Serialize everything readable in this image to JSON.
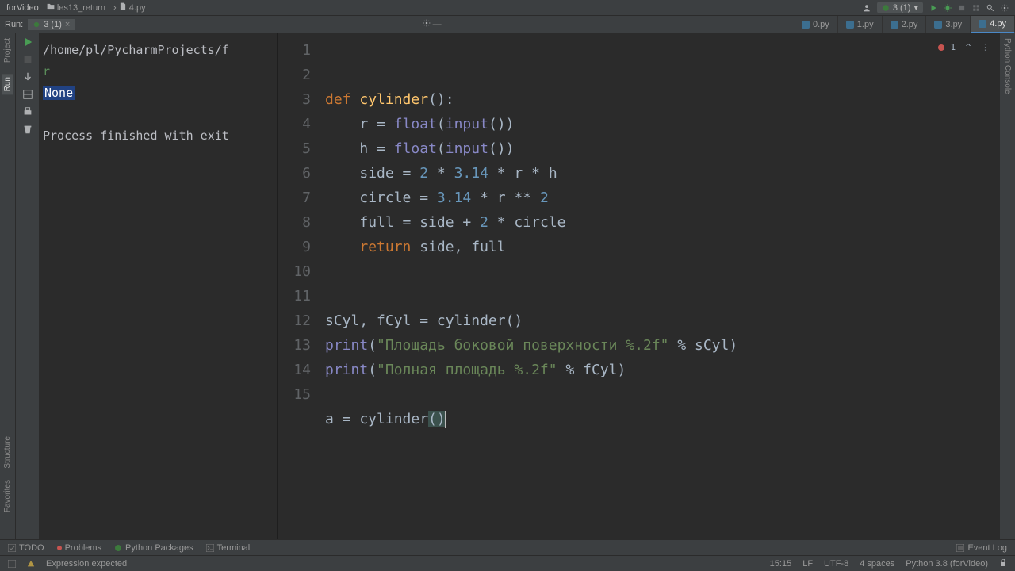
{
  "menubar": {
    "project": "forVideo",
    "breadcrumb_dir": "les13_return",
    "breadcrumb_file": "4.py"
  },
  "top_right": {
    "run_config": "3 (1)"
  },
  "run_label": "Run:",
  "run_config_tab": "3 (1)",
  "gear": "gear",
  "filetabs": [
    {
      "label": "0.py",
      "active": false
    },
    {
      "label": "1.py",
      "active": false
    },
    {
      "label": "2.py",
      "active": false
    },
    {
      "label": "3.py",
      "active": false
    },
    {
      "label": "4.py",
      "active": true
    }
  ],
  "rails_left": [
    "Project",
    "Run",
    "Structure",
    "Favorites"
  ],
  "rails_right": "Python Console",
  "run_output": {
    "path": "/home/pl/PycharmProjects/f",
    "r": "r",
    "none": "None",
    "exit": "Process finished with exit"
  },
  "code_lines": [
    "1",
    "2",
    "3",
    "4",
    "5",
    "6",
    "7",
    "8",
    "9",
    "10",
    "11",
    "12",
    "13",
    "14",
    "15"
  ],
  "code": {
    "def": "def",
    "cyl": "cylinder",
    "paren_empty": "()",
    "colon": ":",
    "r_eq": "r = ",
    "h_eq": "h = ",
    "float": "float",
    "input": "input",
    "side_eq": "side = ",
    "two": "2",
    "star": " * ",
    "pi": "3.14",
    "r": "r",
    "h": "h",
    "circle_eq": "circle = ",
    "dstar": " ** ",
    "full_eq": "full = side + ",
    "circ": " * circle",
    "return": "return",
    "sf": " side, full",
    "assign_sf": "sCyl, fCyl = cylinder()",
    "print": "print",
    "s1": "\"Площадь боковой поверхности %.2f\"",
    "pct_s": " % sCyl)",
    "s2": "\"Полная площадь %.2f\"",
    "pct_f": " % fCyl)",
    "a_eq": "a = cylinder",
    "po": "(",
    "pc": ")"
  },
  "err_corner": "1",
  "bottom_tools": [
    "TODO",
    "Problems",
    "Python Packages",
    "Terminal"
  ],
  "event_log": "Event Log",
  "status_left": "Expression expected",
  "status_right": [
    "15:15",
    "LF",
    "UTF-8",
    "4 spaces",
    "Python 3.8 (forVideo)"
  ]
}
